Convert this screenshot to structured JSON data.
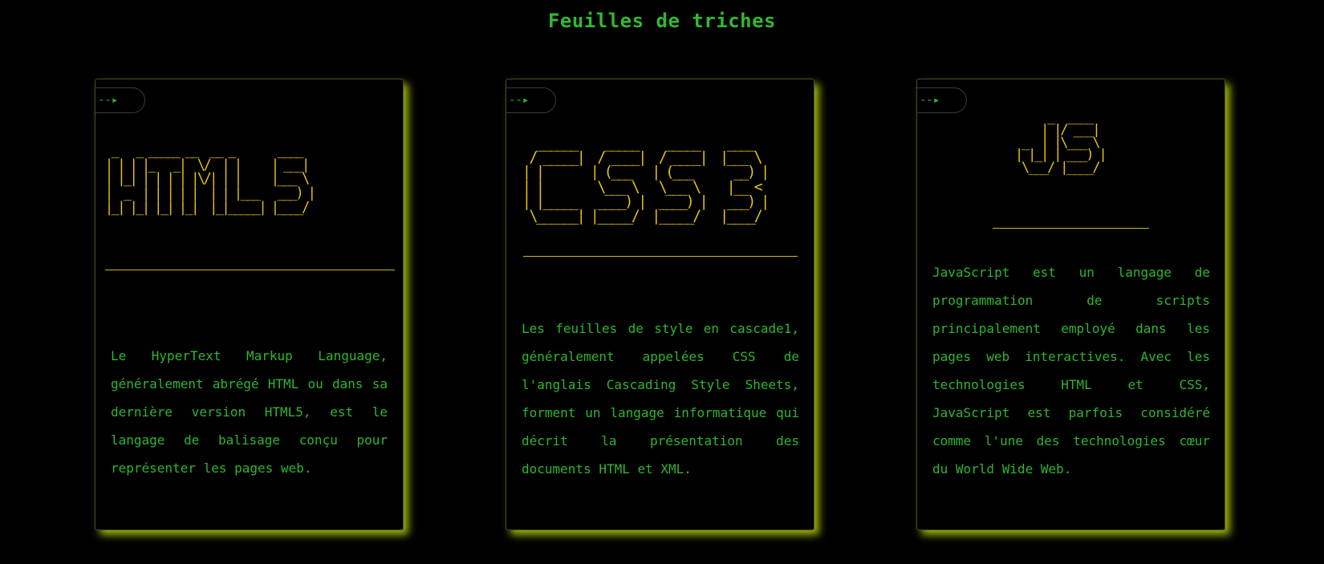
{
  "header": {
    "title": "Feuilles de triches"
  },
  "cards": [
    {
      "badge": "--▸",
      "ascii_title": " _   _ _____ __  __ _       ____\n| | | |_   _|  \\/  | |     | ___|\n| |_| | | | | |\\/| | |     |___ \\\n|  _  | | | | |  | | |___   ___) |\n|_| |_| |_| |_|  |_|_____| |____/",
      "description": "Le HyperText Markup Language, généralement abrégé HTML ou dans sa dernière version HTML5, est le langage de balisage conçu pour représenter les pages web."
    },
    {
      "badge": "--▸",
      "ascii_title": "  ______    _____    _____    ____\n / _____|  / ____|  / ____|  |___ \\\n| |       | (___   | (___      __) |\n| |        \\___ \\   \\___ \\    |__ <\n| |_____   ____) |  ____) |   ___) |\n \\______| |_____/  |_____/   |____/",
      "description": "Les feuilles de style en cascade1, généralement appelées CSS de l'anglais Cascading Style Sheets, forment un langage informatique qui décrit la présentation des documents HTML et XML."
    },
    {
      "badge": "--▸",
      "ascii_title": "     _  ____\n    | |/ ___|\n _  | |\\___ \\\n| |_| | ___) |\n \\___/ |____/",
      "description": "JavaScript est un langage de programmation de scripts principalement employé dans les pages web interactives. Avec les technologies HTML et CSS, JavaScript est parfois considéré comme l'une des technologies cœur du World Wide Web."
    }
  ],
  "colors": {
    "background": "#000000",
    "text_green": "#2fb52f",
    "ascii_yellow": "#e6c419",
    "card_glow": "#9db00a"
  },
  "icons": {
    "badge_arrow": "arrow-right-icon"
  }
}
